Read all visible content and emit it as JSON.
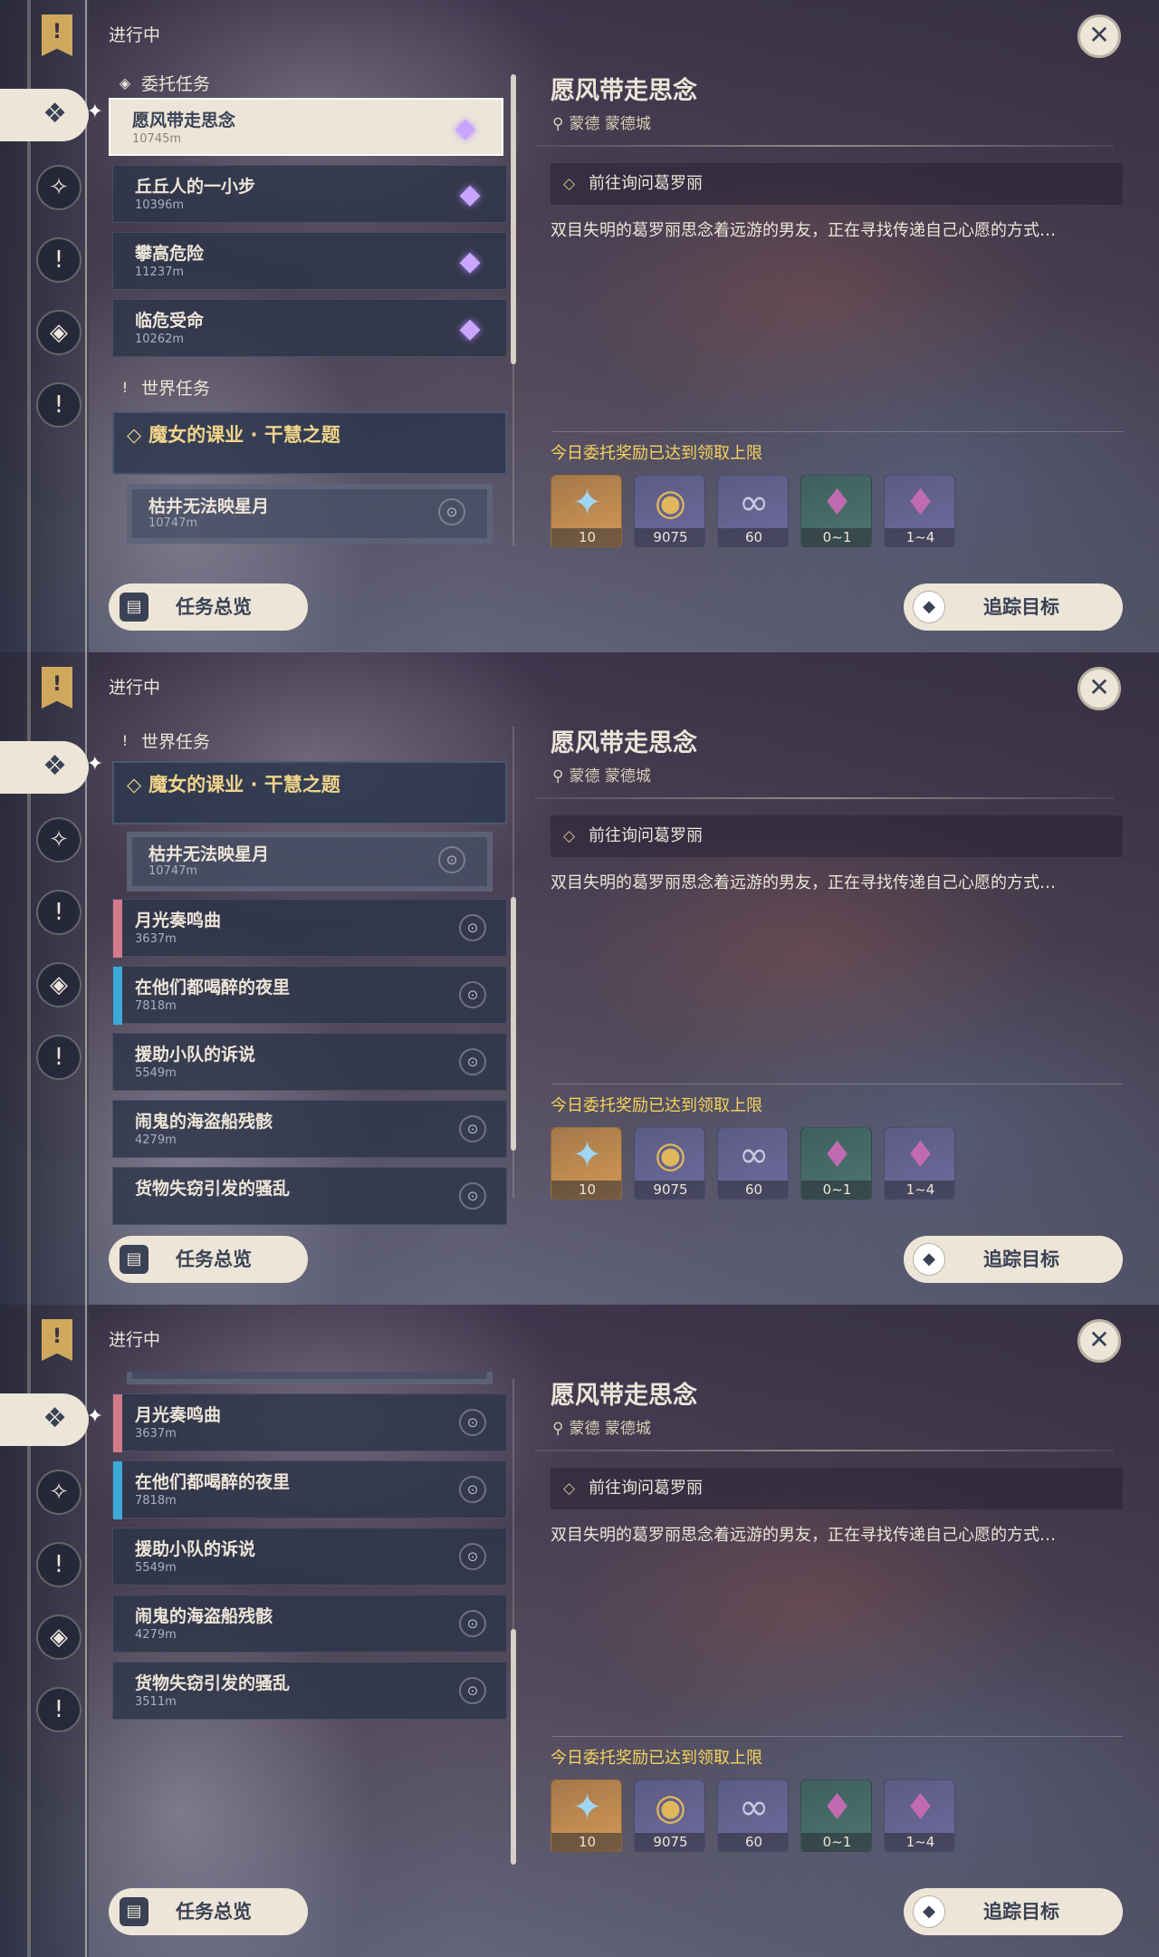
{
  "status_title": "进行中",
  "close_icon": "✕",
  "commission_section": "委托任务",
  "world_section": "世界任务",
  "commissions": [
    {
      "name": "愿风带走思念",
      "dist": "10745m"
    },
    {
      "name": "丘丘人的一小步",
      "dist": "10396m"
    },
    {
      "name": "攀高危险",
      "dist": "11237m"
    },
    {
      "name": "临危受命",
      "dist": "10262m"
    }
  ],
  "world_quest": {
    "title": "魔女的课业 · 干慧之题",
    "sub": {
      "name": "枯井无法映星月",
      "dist": "10747m"
    }
  },
  "other_tasks": [
    {
      "name": "月光奏鸣曲",
      "dist": "3637m",
      "stripe": "#d27a8a"
    },
    {
      "name": "在他们都喝醉的夜里",
      "dist": "7818m",
      "stripe": "#3fa9d6"
    },
    {
      "name": "援助小队的诉说",
      "dist": "5549m",
      "stripe": ""
    },
    {
      "name": "闹鬼的海盗船残骸",
      "dist": "4279m",
      "stripe": ""
    },
    {
      "name": "货物失窃引发的骚乱",
      "dist": "3511m",
      "stripe": ""
    }
  ],
  "detail": {
    "title": "愿风带走思念",
    "location": "蒙德 蒙德城",
    "objective": "前往询问葛罗丽",
    "description": "双目失明的葛罗丽思念着远游的男友，正在寻找传递自己心愿的方式…",
    "reward_note": "今日委托奖励已达到领取上限"
  },
  "rewards": [
    {
      "icon": "✦",
      "qty": "10",
      "color": "#9fd6f5",
      "bg": "r-orange"
    },
    {
      "icon": "◉",
      "qty": "9075",
      "color": "#e0b75a",
      "bg": "r-purple"
    },
    {
      "icon": "∞",
      "qty": "60",
      "color": "#c7cbe0",
      "bg": "r-purple"
    },
    {
      "icon": "♦",
      "qty": "0~1",
      "color": "#c06bb0",
      "bg": "r-green"
    },
    {
      "icon": "♦",
      "qty": "1~4",
      "color": "#c06bb0",
      "bg": "r-purple"
    }
  ],
  "buttons": {
    "overview": "任务总览",
    "track": "追踪目标"
  }
}
